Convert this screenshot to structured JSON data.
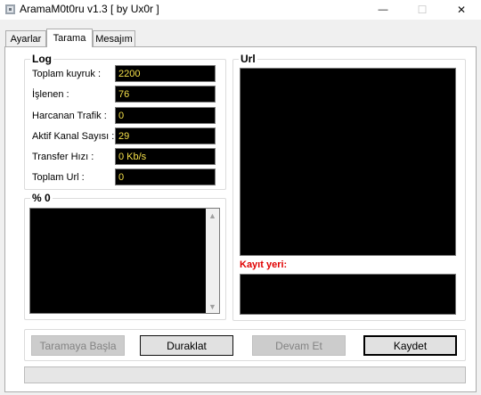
{
  "window": {
    "title": "AramaM0t0ru v1.3 [ by Ux0r ]",
    "controls": {
      "minimize": "—",
      "maximize": "☐",
      "close": "✕"
    }
  },
  "tabs": [
    {
      "label": "Ayarlar"
    },
    {
      "label": "Tarama",
      "active": true
    },
    {
      "label": "Mesajım"
    }
  ],
  "log": {
    "title": "Log",
    "rows": [
      {
        "label": "Toplam kuyruk :",
        "value": "2200"
      },
      {
        "label": "İşlenen :",
        "value": "76"
      },
      {
        "label": "Harcanan Trafik :",
        "value": "0"
      },
      {
        "label": "Aktif Kanal Sayısı :",
        "value": "29"
      },
      {
        "label": "Transfer Hızı :",
        "value": "0 Kb/s"
      },
      {
        "label": "Toplam Url :",
        "value": "0"
      }
    ]
  },
  "progress_group": {
    "title": "% 0"
  },
  "url_group": {
    "title": "Url",
    "save_location_label": "Kayıt yeri:"
  },
  "buttons": {
    "start": "Taramaya Başla",
    "pause": "Duraklat",
    "resume": "Devam Et",
    "save": "Kaydet"
  },
  "progress": {
    "value": 0
  },
  "colors": {
    "value_text": "#f5e04a",
    "save_location_label": "#e00000",
    "box_bg": "#000000"
  }
}
